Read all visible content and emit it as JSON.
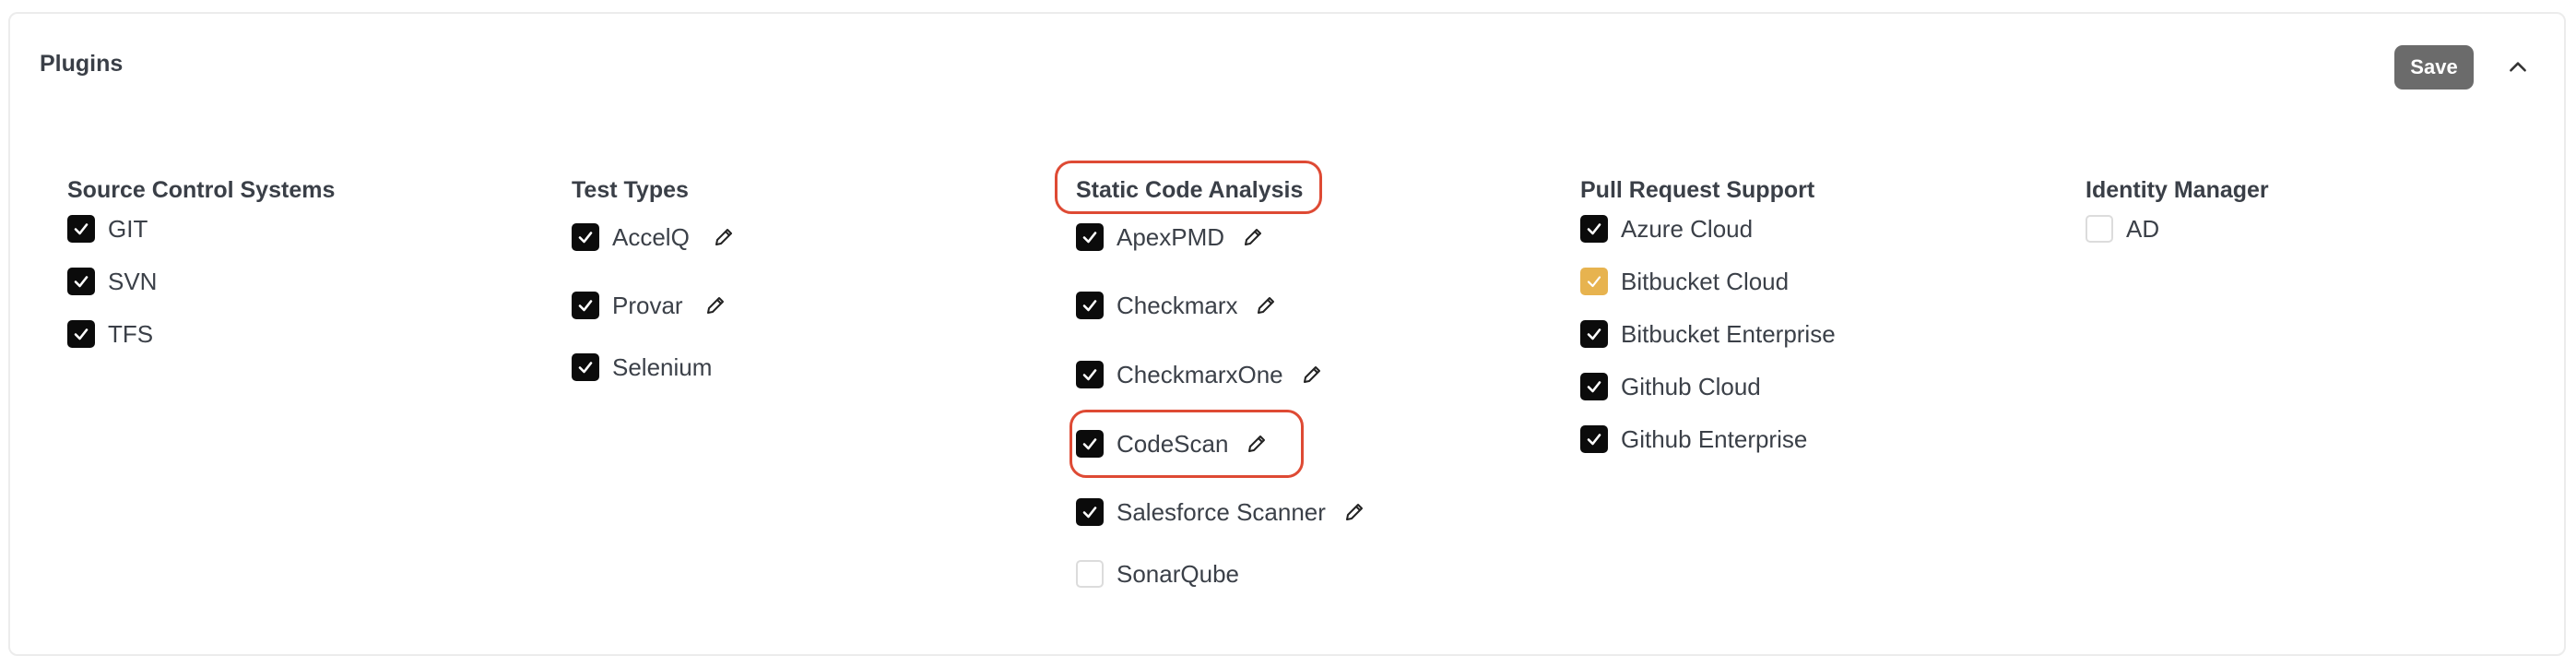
{
  "panel": {
    "title": "Plugins",
    "save_label": "Save"
  },
  "colors": {
    "checked": "#0b0b0b",
    "partial": "#e7b34f",
    "highlight": "#de4a34",
    "save_bg": "#6b6b6b"
  },
  "columns": [
    {
      "title": "Source Control Systems",
      "items": [
        {
          "label": "GIT",
          "state": "checked",
          "editable": false
        },
        {
          "label": "SVN",
          "state": "checked",
          "editable": false
        },
        {
          "label": "TFS",
          "state": "checked",
          "editable": false
        }
      ]
    },
    {
      "title": "Test Types",
      "items": [
        {
          "label": "AccelQ",
          "state": "checked",
          "editable": true
        },
        {
          "label": "Provar",
          "state": "checked",
          "editable": true
        },
        {
          "label": "Selenium",
          "state": "checked",
          "editable": false
        }
      ]
    },
    {
      "title": "Static Code Analysis",
      "items": [
        {
          "label": "ApexPMD",
          "state": "checked",
          "editable": true
        },
        {
          "label": "Checkmarx",
          "state": "checked",
          "editable": true
        },
        {
          "label": "CheckmarxOne",
          "state": "checked",
          "editable": true
        },
        {
          "label": "CodeScan",
          "state": "checked",
          "editable": true
        },
        {
          "label": "Salesforce Scanner",
          "state": "checked",
          "editable": true
        },
        {
          "label": "SonarQube",
          "state": "unchecked",
          "editable": false
        }
      ]
    },
    {
      "title": "Pull Request Support",
      "items": [
        {
          "label": "Azure Cloud",
          "state": "checked",
          "editable": false
        },
        {
          "label": "Bitbucket Cloud",
          "state": "checked-disabled",
          "editable": false
        },
        {
          "label": "Bitbucket Enterprise",
          "state": "checked",
          "editable": false
        },
        {
          "label": "Github Cloud",
          "state": "checked",
          "editable": false
        },
        {
          "label": "Github Enterprise",
          "state": "checked",
          "editable": false
        }
      ]
    },
    {
      "title": "Identity Manager",
      "items": [
        {
          "label": "AD",
          "state": "unchecked",
          "editable": false
        }
      ]
    }
  ],
  "icons": {
    "collapse": "chevron-up-icon",
    "edit": "pencil-icon",
    "check": "check-icon"
  }
}
